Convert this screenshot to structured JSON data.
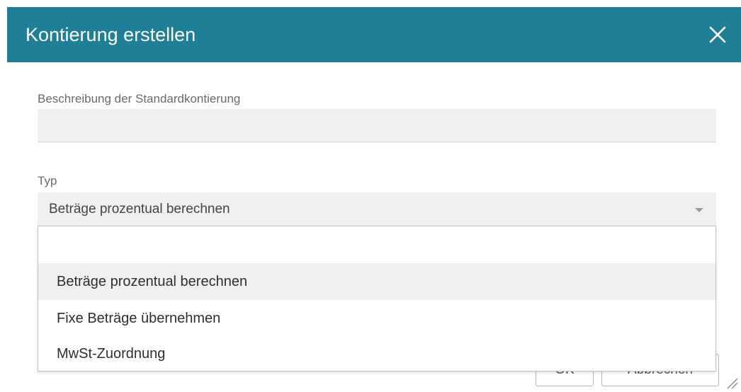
{
  "dialog": {
    "title": "Kontierung erstellen",
    "close_icon": "close-icon",
    "header_color": "#1f7f96"
  },
  "form": {
    "description_label": "Beschreibung der Standardkontierung",
    "description_value": "",
    "type_label": "Typ",
    "type_selected": "Beträge prozentual berechnen",
    "type_arrow_icon": "dropdown-arrow-icon"
  },
  "dropdown": {
    "search_value": "",
    "options": [
      "Beträge prozentual berechnen",
      "Fixe Beträge übernehmen",
      "MwSt-Zuordnung"
    ],
    "highlighted_index": 0
  },
  "buttons": {
    "ok_label": "OK",
    "cancel_label": "Abbrechen"
  },
  "resize_icon": "resize-handle-icon"
}
